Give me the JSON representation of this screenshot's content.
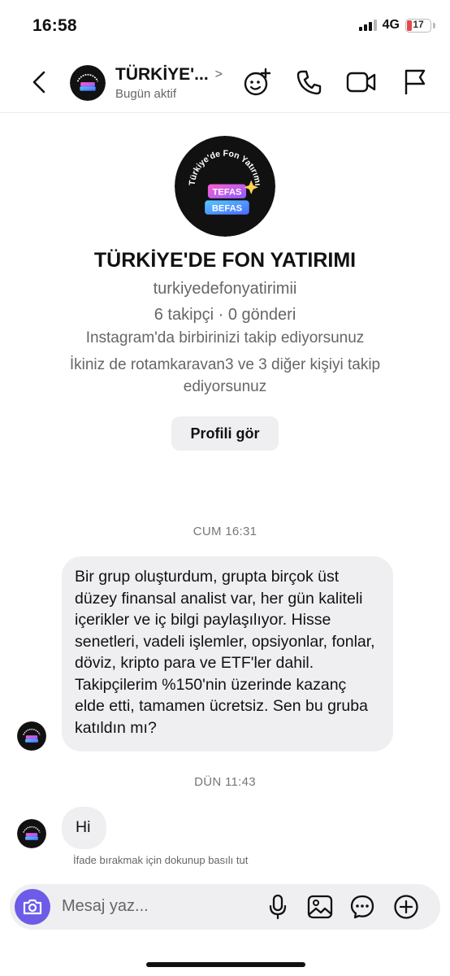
{
  "status_bar": {
    "time": "16:58",
    "network": "4G",
    "battery": "17"
  },
  "header": {
    "title": "TÜRKİYE'...",
    "chevron": ">",
    "subtitle": "Bugün aktif"
  },
  "avatar": {
    "top_text": "Türkiye'de Fon Yatırımı",
    "word1": "TEFAS",
    "word2": "BEFAS"
  },
  "profile": {
    "name": "TÜRKİYE'DE FON YATIRIMI",
    "username": "turkiyedefonyatirimii",
    "stats": "6 takipçi · 0 gönderi",
    "follow_status": "Instagram'da birbirinizi takip ediyorsunuz",
    "mutual": "İkiniz de rotamkaravan3 ve 3 diğer kişiyi takip ediyorsunuz",
    "view_profile_button": "Profili gör"
  },
  "messages": [
    {
      "time": "CUM 16:31",
      "text": "Bir grup oluşturdum, grupta birçok üst düzey finansal analist var, her gün kaliteli içerikler ve iç bilgi paylaşılıyor. Hisse senetleri, vadeli işlemler, opsiyonlar, fonlar, döviz, kripto para ve ETF'ler dahil. Takipçilerim %150'nin üzerinde kazanç elde etti, tamamen ücretsiz. Sen bu gruba katıldın mı?"
    },
    {
      "time": "DÜN 11:43",
      "text": "Hi"
    }
  ],
  "reaction_hint": "İfade bırakmak için dokunup basılı tut",
  "composer": {
    "placeholder": "Mesaj yaz..."
  },
  "colors": {
    "camera_button": "#6c5ce7",
    "bubble": "#efeff1",
    "avatar_bg": "#111111",
    "battery_low": "#e5484d"
  },
  "icons": {
    "header": [
      "back-arrow-icon",
      "sticker-icon",
      "phone-icon",
      "video-icon",
      "flag-icon"
    ],
    "composer": [
      "camera-icon",
      "microphone-icon",
      "gallery-icon",
      "sticker-chat-icon",
      "plus-icon"
    ]
  }
}
